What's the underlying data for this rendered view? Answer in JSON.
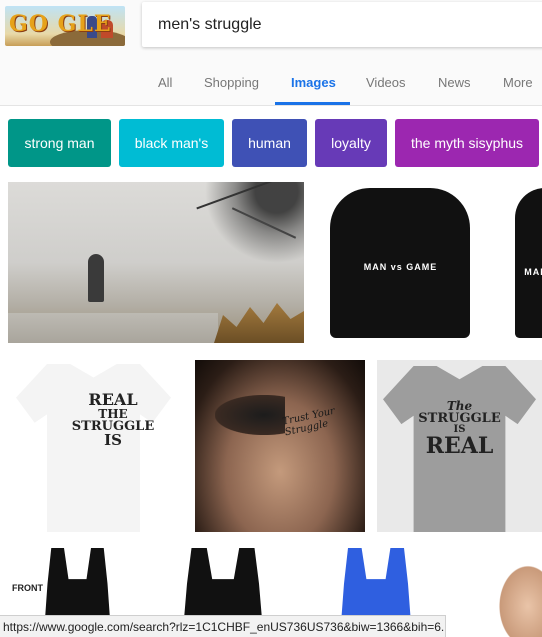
{
  "search": {
    "query": "men's struggle"
  },
  "tabs": [
    {
      "label": "All"
    },
    {
      "label": "Shopping"
    },
    {
      "label": "Images"
    },
    {
      "label": "Videos"
    },
    {
      "label": "News"
    },
    {
      "label": "More"
    }
  ],
  "active_tab": "Images",
  "chips": [
    {
      "label": "strong man",
      "color": "#009688"
    },
    {
      "label": "black man's",
      "color": "#00bcd4"
    },
    {
      "label": "human",
      "color": "#3f51b5"
    },
    {
      "label": "loyalty",
      "color": "#673ab7"
    },
    {
      "label": "the myth sisyphus",
      "color": "#9c27b0"
    }
  ],
  "images": {
    "doodle_text": "GO GLE",
    "hoodie_print": "MAN vs GAME",
    "hoodie2_print": "MAN",
    "white_tee_print": [
      "REAL",
      "THE",
      "STRUGGLE",
      "IS"
    ],
    "chest_tattoo_text": "Trust Your Struggle",
    "grey_tee_print": [
      "The",
      "STRUGGLE",
      "IS",
      "REAL"
    ],
    "tank_label": "FRONT"
  },
  "status": {
    "url": "https://www.google.com/search?rlz=1C1CHBF_enUS736US736&biw=1366&bih=6..."
  },
  "colors": {
    "accent": "#1a73e8",
    "tab_inactive": "#777777"
  }
}
